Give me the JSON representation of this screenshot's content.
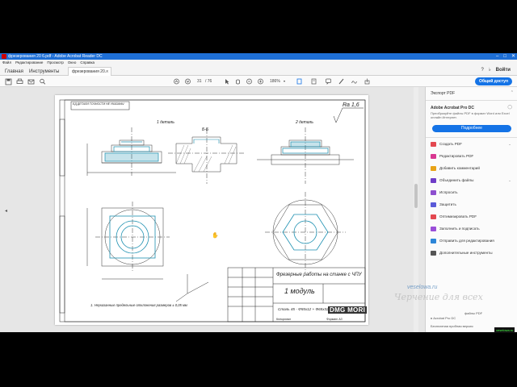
{
  "window": {
    "title": "фрезерования 20 6.pdf - Adobe Acrobat Reader DC",
    "controls": [
      "–",
      "□",
      "✕"
    ]
  },
  "menu": [
    "Файл",
    "Редактирование",
    "Просмотр",
    "Окно",
    "Справка"
  ],
  "tabs": {
    "home": "Главная",
    "tools": "Инструменты",
    "document": "фрезерования 20...",
    "doc_close": "×",
    "sign_in": "Войти"
  },
  "toolbar": {
    "page_current": "31",
    "page_total": "/ 76",
    "zoom": "186%",
    "share_label": "Общий доступ"
  },
  "panel": {
    "export_label": "Экспорт PDF",
    "product": "Adobe Acrobat Pro DC",
    "description": "Преобразуйте файлы PDF в формат Word или Excel онлайн Интернет.",
    "more_button": "Подробнее",
    "tools": [
      {
        "label": "Создать PDF",
        "color": "#e34850"
      },
      {
        "label": "Редактировать PDF",
        "color": "#d83790"
      },
      {
        "label": "Добавить комментарий",
        "color": "#e8a317"
      },
      {
        "label": "Объединить файлы",
        "color": "#6f3dc8"
      },
      {
        "label": "Испросить",
        "color": "#8d4fcf"
      },
      {
        "label": "Защитить",
        "color": "#5a5ad8"
      },
      {
        "label": "Оптимизировать PDF",
        "color": "#e34850"
      },
      {
        "label": "Заполнить и подписать",
        "color": "#9a4ed8"
      },
      {
        "label": "Отправить для редактирования",
        "color": "#2d86d8"
      },
      {
        "label": "Дополнительные инструменты",
        "color": "#555555"
      }
    ],
    "promo_line1": "файлы PDF",
    "promo_line2": "в Acrobat Pro DC",
    "promo_line3": "Бесплатная пробная версия"
  },
  "drawing": {
    "stamp": "ЕД ДЕТАЛИ ТОЧНОСТИ НЕ УКАЗАНЫ",
    "view1": "1 деталь",
    "view2": "2 деталь",
    "section": "Б-Б",
    "roughness": "Ra 1,6",
    "note": "1. Неуказанные предельные отклонения размеров ± 0,05 мм",
    "title_main": "Фрезерные работы на станке с ЧПУ",
    "title_sub": "1 модуль",
    "material": "Сталь 45 - Ф55х12 + Ф65х32",
    "brand": "DMG MORI",
    "sheet": "Копировал",
    "format": "Формат  А3"
  },
  "watermark": {
    "site": "veselowa.ru",
    "brand": "Черчение для всех"
  },
  "corner_logo": "veselowa.ru"
}
